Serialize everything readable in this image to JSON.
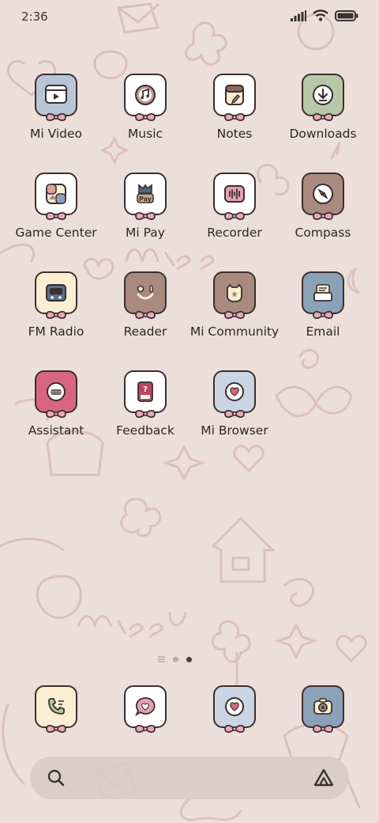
{
  "status": {
    "time": "2:36"
  },
  "apps": [
    {
      "label": "Mi Video",
      "icon": "video-icon",
      "bg": "#b8c5d6"
    },
    {
      "label": "Music",
      "icon": "music-icon",
      "bg": "#ffffff"
    },
    {
      "label": "Notes",
      "icon": "notes-icon",
      "bg": "#ffffff"
    },
    {
      "label": "Downloads",
      "icon": "download-icon",
      "bg": "#b7c7a8"
    },
    {
      "label": "Game Center",
      "icon": "game-center-icon",
      "bg": "#ffffff"
    },
    {
      "label": "Mi Pay",
      "icon": "mi-pay-icon",
      "bg": "#ffffff"
    },
    {
      "label": "Recorder",
      "icon": "recorder-icon",
      "bg": "#ffffff"
    },
    {
      "label": "Compass",
      "icon": "compass-icon",
      "bg": "#a88a7e"
    },
    {
      "label": "FM Radio",
      "icon": "radio-icon",
      "bg": "#fbeed3"
    },
    {
      "label": "Reader",
      "icon": "reader-icon",
      "bg": "#a88a7e"
    },
    {
      "label": "Mi Community",
      "icon": "community-icon",
      "bg": "#a88a7e"
    },
    {
      "label": "Email",
      "icon": "email-icon",
      "bg": "#8aa1b8"
    },
    {
      "label": "Assistant",
      "icon": "assistant-icon",
      "bg": "#d9667f"
    },
    {
      "label": "Feedback",
      "icon": "feedback-icon",
      "bg": "#ffffff"
    },
    {
      "label": "Mi Browser",
      "icon": "browser-icon",
      "bg": "#c9d5e2"
    }
  ],
  "dock": [
    {
      "name": "phone",
      "icon": "phone-icon",
      "bg": "#fbeed3"
    },
    {
      "name": "messaging",
      "icon": "message-icon",
      "bg": "#ffffff"
    },
    {
      "name": "browser",
      "icon": "browser-icon",
      "bg": "#c9d5e2"
    },
    {
      "name": "camera",
      "icon": "camera-icon",
      "bg": "#8aa1b8"
    }
  ],
  "page_indicator": {
    "pages": 3,
    "active": 2
  },
  "colors": {
    "outline": "#3a2f2f",
    "bow": "#e9a9b6",
    "accent": "#d9667f"
  }
}
